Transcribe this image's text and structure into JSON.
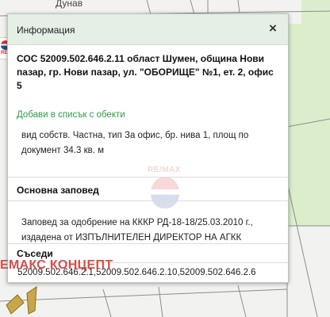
{
  "map": {
    "street_label": "Дунав",
    "logo_peek_text": "RE/"
  },
  "popup": {
    "title": "Информация",
    "close_glyph": "×",
    "address": "СОС 52009.502.646.2.11 област Шумен, община Нови пазар, гр. Нови пазар, ул. \"ОБОРИЩЕ\" №1, ет. 2, офис 5",
    "add_to_list": "Добави в списък с обекти",
    "details": "вид собств. Частна, тип За офис, бр. нива 1, площ по документ 34.3 кв. м",
    "order_heading": "Основна заповед",
    "order_text": "Заповед за одобрение на КККР РД-18-18/25.03.2010 г., издадена от ИЗПЪЛНИТЕЛЕН ДИРЕКТОР НА АГКК",
    "neighbours_heading": "Съседи",
    "neighbours": "52009.502.646.2.1,52009.502.646.2.10,52009.502.646.2.6"
  },
  "watermark": {
    "text": "RE/MAX"
  },
  "brand_overlay": "ЕМАКС КОНЦЕПТ",
  "colors": {
    "header_bg": "#e5efe6",
    "link_green": "#2f9a4a",
    "brand_red": "#d3302a",
    "map_green": "#dcedcc"
  }
}
